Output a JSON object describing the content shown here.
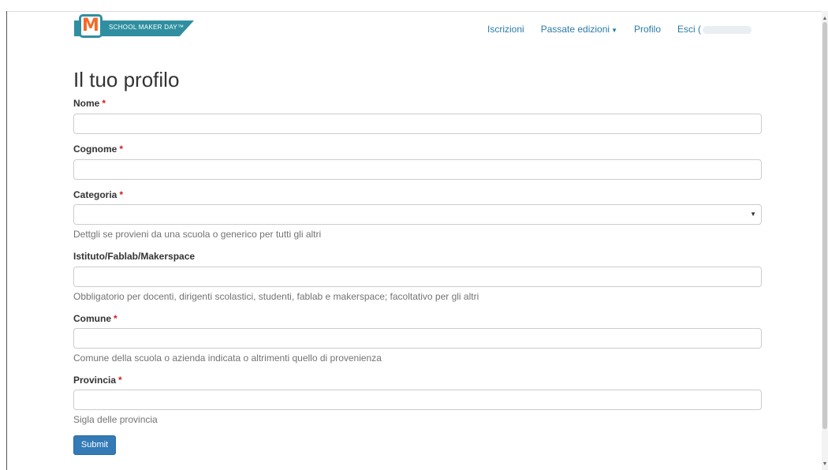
{
  "brand": {
    "logo_letter": "M",
    "logo_text": "SCHOOL MAKER DAY™"
  },
  "nav": {
    "iscrizioni": "Iscrizioni",
    "passate_edizioni": "Passate edizioni",
    "profilo": "Profilo",
    "esci": "Esci ("
  },
  "page": {
    "title": "Il tuo profilo"
  },
  "form": {
    "nome_label": "Nome",
    "cognome_label": "Cognome",
    "categoria_label": "Categoria",
    "categoria_help": "Dettgli se provieni da una scuola o generico per tutti gli altri",
    "istituto_label": "Istituto/Fablab/Makerspace",
    "istituto_help": "Obbligatorio per docenti, dirigenti scolastici, studenti, fablab e makerspace; facoltativo per gli altri",
    "comune_label": "Comune",
    "comune_help": "Comune della scuola o azienda indicata o altrimenti quello di provenienza",
    "provincia_label": "Provincia",
    "provincia_help": "Sigla delle provincia",
    "required_mark": "*",
    "submit_label": "Submit"
  }
}
